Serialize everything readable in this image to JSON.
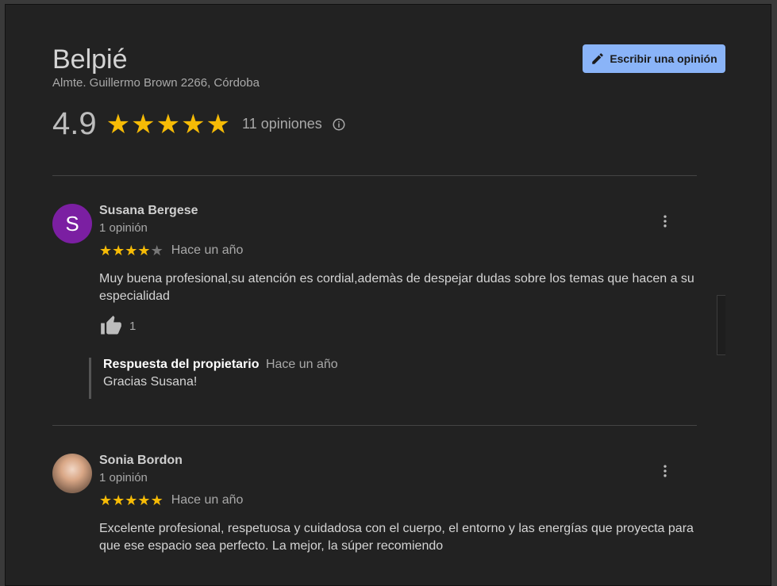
{
  "business": {
    "name": "Belpié",
    "address": "Almte. Guillermo Brown 2266, Córdoba",
    "rating": "4.9",
    "rating_stars": 5,
    "review_count_label": "11 opiniones"
  },
  "actions": {
    "write_review_label": "Escribir una opinión"
  },
  "colors": {
    "accent": "#8ab4f8",
    "star": "#f6bb06",
    "avatar_purple": "#7b1fa2"
  },
  "reviews": [
    {
      "avatar_letter": "S",
      "name": "Susana Bergese",
      "meta": "1 opinión",
      "stars": 4,
      "date": "Hace un año",
      "text": "Muy buena profesional,su atención es cordial,ademàs de despejar dudas sobre los temas que hacen a su especialidad",
      "likes": "1",
      "owner_reply": {
        "title": "Respuesta del propietario",
        "date": "Hace un año",
        "text": "Gracias Susana!"
      }
    },
    {
      "avatar_letter": "",
      "name": "Sonia Bordon",
      "meta": "1 opinión",
      "stars": 5,
      "date": "Hace un año",
      "text": "Excelente  profesional, respetuosa y  cuidadosa con el cuerpo, el entorno y las energías que proyecta para que ese espacio sea perfecto. La mejor, la súper recomiendo"
    }
  ]
}
